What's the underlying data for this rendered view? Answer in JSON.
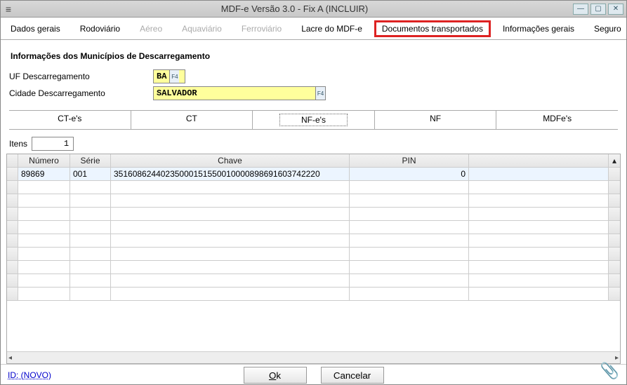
{
  "window": {
    "title": "MDF-e Versão 3.0 - Fix A (INCLUIR)"
  },
  "mainTabs": {
    "dadosGerais": "Dados gerais",
    "rodoviario": "Rodoviário",
    "aereo": "Aéreo",
    "aquaviario": "Aquaviário",
    "ferroviario": "Ferroviário",
    "lacre": "Lacre do MDF-e",
    "documentos": "Documentos transportados",
    "infoGerais": "Informações gerais",
    "seguro": "Seguro"
  },
  "section": {
    "title": "Informações dos Municípios de Descarregamento",
    "ufLabel": "UF Descarregamento",
    "ufValue": "BA",
    "cidadeLabel": "Cidade Descarregamento",
    "cidadeValue": "SALVADOR"
  },
  "subTabs": {
    "ctes": "CT-e's",
    "ct": "CT",
    "nfes": "NF-e's",
    "nf": "NF",
    "mdfes": "MDFe's"
  },
  "items": {
    "label": "Itens",
    "count": "1"
  },
  "grid": {
    "headers": {
      "numero": "Número",
      "serie": "Série",
      "chave": "Chave",
      "pin": "PIN"
    },
    "row1": {
      "numero": "89869",
      "serie": "001",
      "chave": "35160862440235000151550010000898691603742220",
      "pin": "0"
    }
  },
  "footer": {
    "id": "ID: (NOVO)",
    "ok": "Ok",
    "cancel": "Cancelar"
  }
}
